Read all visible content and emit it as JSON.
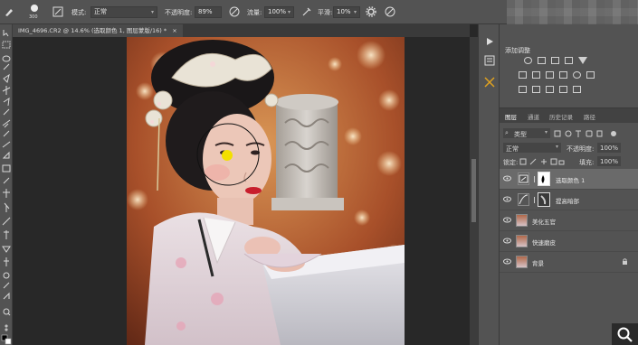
{
  "options_bar": {
    "brush_size": "300",
    "mode_label": "模式:",
    "mode_value": "正常",
    "opacity_label": "不透明度:",
    "opacity_value": "89%",
    "flow_label": "流量:",
    "flow_value": "100%",
    "smoothing_label": "平滑:",
    "smoothing_value": "10%"
  },
  "document_tab": {
    "title": "IMG_4696.CR2 @ 14.6% (选取颜色 1, 图层蒙版/16) *",
    "close": "×"
  },
  "adjustments_panel": {
    "title": "添加调整",
    "icon_rows": [
      [
        "brightness-icon",
        "levels-icon",
        "curves-icon",
        "exposure-icon",
        "vibrance-icon"
      ],
      [
        "hue-sat-icon",
        "color-balance-icon",
        "bw-icon",
        "photo-filter-icon",
        "channel-mixer-icon",
        "color-lookup-icon"
      ],
      [
        "invert-icon",
        "posterize-icon",
        "threshold-icon",
        "gradient-map-icon",
        "selective-color-icon"
      ]
    ]
  },
  "layers_panel": {
    "tabs": [
      "图层",
      "通道",
      "历史记录",
      "路径"
    ],
    "active_tab": 0,
    "filter_label": "类型",
    "blend_mode": "正常",
    "opacity_label": "不透明度:",
    "opacity_value": "100%",
    "lock_label": "锁定:",
    "fill_label": "填充:",
    "fill_value": "100%",
    "layers": [
      {
        "name": "选取颜色 1",
        "kind": "adjustment",
        "selected": true
      },
      {
        "name": "提高暗部",
        "kind": "adjustment",
        "selected": false
      },
      {
        "name": "美化五官",
        "kind": "pixel",
        "selected": false
      },
      {
        "name": "快速磨皮",
        "kind": "pixel",
        "selected": false
      },
      {
        "name": "背景",
        "kind": "background",
        "selected": false
      }
    ]
  },
  "colors": {
    "panel_bg": "#535353",
    "canvas_bg": "#282828",
    "brush_cursor": "#f3e000"
  }
}
